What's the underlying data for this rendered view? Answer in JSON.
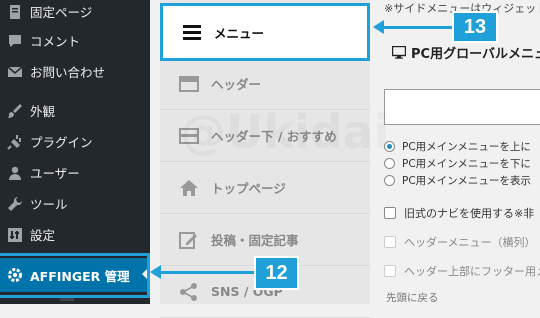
{
  "sidebar": {
    "items": [
      {
        "label": "固定ページ",
        "icon": "page-icon"
      },
      {
        "label": "コメント",
        "icon": "comment-icon"
      },
      {
        "label": "お問い合わせ",
        "icon": "mail-icon"
      },
      {
        "label": "外観",
        "icon": "brush-icon"
      },
      {
        "label": "プラグイン",
        "icon": "plugin-icon"
      },
      {
        "label": "ユーザー",
        "icon": "user-icon"
      },
      {
        "label": "ツール",
        "icon": "wrench-icon"
      },
      {
        "label": "設定",
        "icon": "settings-icon"
      },
      {
        "label": "AFFINGER 管理",
        "icon": "gear-icon",
        "active": true
      }
    ]
  },
  "tabs": {
    "items": [
      {
        "label": "メニュー",
        "icon": "menu-icon",
        "selected": true
      },
      {
        "label": "ヘッダー",
        "icon": "header-layout-icon"
      },
      {
        "label": "ヘッダー下 / おすすめ",
        "icon": "header-below-icon"
      },
      {
        "label": "トップページ",
        "icon": "home-icon"
      },
      {
        "label": "投稿・固定記事",
        "icon": "edit-icon"
      },
      {
        "label": "SNS / OGP",
        "icon": "share-icon"
      }
    ]
  },
  "content": {
    "note": "※サイドメニューはウィジェット",
    "section_title": "PC用グローバルメニュー",
    "radios": [
      {
        "label": "PC用メインメニューを上に",
        "checked": true
      },
      {
        "label": "PC用メインメニューを下に",
        "checked": false
      },
      {
        "label": "PC用メインメニューを表示",
        "checked": false
      }
    ],
    "checks": [
      {
        "label": "旧式のナビを使用する※非",
        "dim": false
      },
      {
        "label": "ヘッダーメニュー（横列）",
        "dim": true
      },
      {
        "label": "ヘッダー上部にフッター用メ",
        "dim": true
      }
    ],
    "reset_link": "先頭に戻る",
    "watermark": "@Ukidai"
  },
  "callouts": {
    "c13": "13",
    "c12": "12"
  },
  "colors": {
    "accent": "#1fa0d8",
    "wp_sidebar": "#23282d",
    "wp_active": "#0073aa"
  }
}
